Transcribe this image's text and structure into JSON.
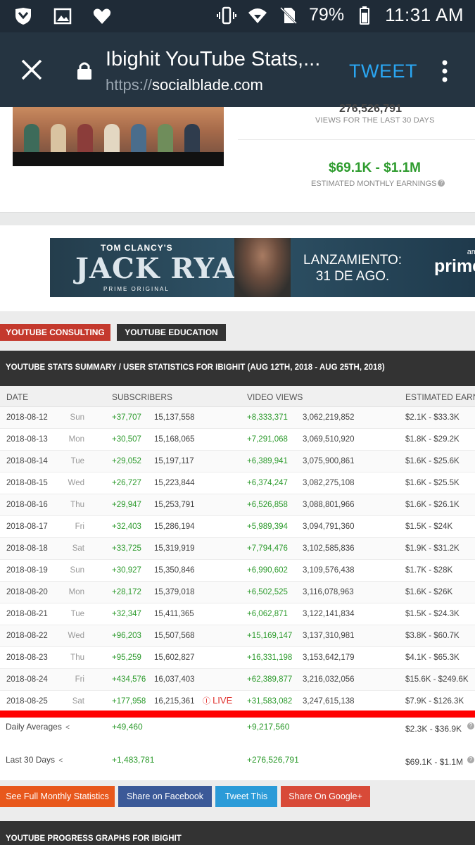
{
  "status_bar": {
    "battery": "79%",
    "time": "11:31 AM",
    "icons": [
      "shield-icon",
      "image-icon",
      "heart-icon",
      "vibrate-icon",
      "wifi-icon",
      "no-sim-icon",
      "battery-icon"
    ]
  },
  "toolbar": {
    "title": "Ibighit YouTube Stats,...",
    "url_protocol": "https://",
    "url_domain": "socialblade.com",
    "tweet_label": "TWEET"
  },
  "top_card": {
    "views_value": "276,526,791",
    "views_label": "VIEWS FOR THE LAST 30 DAYS",
    "earnings_value": "$69.1K - $1.1M",
    "earnings_label": "ESTIMATED MONTHLY EARNINGS"
  },
  "ad": {
    "small": "TOM CLANCY'S",
    "big": "JACK RYAN",
    "sub": "PRIME ORIGINAL",
    "lanz1": "LANZAMIENTO:",
    "lanz2": "31 DE AGO.",
    "brand_top": "ama",
    "brand": "prime"
  },
  "buttons": {
    "consulting": "YOUTUBE CONSULTING",
    "education": "YOUTUBE EDUCATION"
  },
  "summary_title": "YOUTUBE STATS SUMMARY / USER STATISTICS FOR IBIGHIT (AUG 12TH, 2018 - AUG 25TH, 2018)",
  "table": {
    "headers": [
      "DATE",
      "SUBSCRIBERS",
      "VIDEO VIEWS",
      "ESTIMATED EARN"
    ],
    "rows": [
      {
        "date": "2018-08-12",
        "day": "Sun",
        "sub_gain": "+37,707",
        "subs": "15,137,558",
        "view_gain": "+8,333,371",
        "views": "3,062,219,852",
        "earn": "$2.1K  -  $33.3K"
      },
      {
        "date": "2018-08-13",
        "day": "Mon",
        "sub_gain": "+30,507",
        "subs": "15,168,065",
        "view_gain": "+7,291,068",
        "views": "3,069,510,920",
        "earn": "$1.8K  -  $29.2K"
      },
      {
        "date": "2018-08-14",
        "day": "Tue",
        "sub_gain": "+29,052",
        "subs": "15,197,117",
        "view_gain": "+6,389,941",
        "views": "3,075,900,861",
        "earn": "$1.6K  -  $25.6K"
      },
      {
        "date": "2018-08-15",
        "day": "Wed",
        "sub_gain": "+26,727",
        "subs": "15,223,844",
        "view_gain": "+6,374,247",
        "views": "3,082,275,108",
        "earn": "$1.6K  -  $25.5K"
      },
      {
        "date": "2018-08-16",
        "day": "Thu",
        "sub_gain": "+29,947",
        "subs": "15,253,791",
        "view_gain": "+6,526,858",
        "views": "3,088,801,966",
        "earn": "$1.6K  -  $26.1K"
      },
      {
        "date": "2018-08-17",
        "day": "Fri",
        "sub_gain": "+32,403",
        "subs": "15,286,194",
        "view_gain": "+5,989,394",
        "views": "3,094,791,360",
        "earn": "$1.5K  -  $24K"
      },
      {
        "date": "2018-08-18",
        "day": "Sat",
        "sub_gain": "+33,725",
        "subs": "15,319,919",
        "view_gain": "+7,794,476",
        "views": "3,102,585,836",
        "earn": "$1.9K  -  $31.2K"
      },
      {
        "date": "2018-08-19",
        "day": "Sun",
        "sub_gain": "+30,927",
        "subs": "15,350,846",
        "view_gain": "+6,990,602",
        "views": "3,109,576,438",
        "earn": "$1.7K  -  $28K"
      },
      {
        "date": "2018-08-20",
        "day": "Mon",
        "sub_gain": "+28,172",
        "subs": "15,379,018",
        "view_gain": "+6,502,525",
        "views": "3,116,078,963",
        "earn": "$1.6K  -  $26K"
      },
      {
        "date": "2018-08-21",
        "day": "Tue",
        "sub_gain": "+32,347",
        "subs": "15,411,365",
        "view_gain": "+6,062,871",
        "views": "3,122,141,834",
        "earn": "$1.5K  -  $24.3K"
      },
      {
        "date": "2018-08-22",
        "day": "Wed",
        "sub_gain": "+96,203",
        "subs": "15,507,568",
        "view_gain": "+15,169,147",
        "views": "3,137,310,981",
        "earn": "$3.8K  -  $60.7K"
      },
      {
        "date": "2018-08-23",
        "day": "Thu",
        "sub_gain": "+95,259",
        "subs": "15,602,827",
        "view_gain": "+16,331,198",
        "views": "3,153,642,179",
        "earn": "$4.1K  -  $65.3K"
      },
      {
        "date": "2018-08-24",
        "day": "Fri",
        "sub_gain": "+434,576",
        "subs": "16,037,403",
        "view_gain": "+62,389,877",
        "views": "3,216,032,056",
        "earn": "$15.6K  -  $249.6K"
      },
      {
        "date": "2018-08-25",
        "day": "Sat",
        "sub_gain": "+177,958",
        "subs": "16,215,361",
        "view_gain": "+31,583,082",
        "views": "3,247,615,138",
        "earn": "$7.9K  -  $126.3K",
        "live": "LIVE"
      }
    ]
  },
  "averages": {
    "daily_label": "Daily Averages",
    "daily_subs": "+49,460",
    "daily_views": "+9,217,560",
    "daily_earn": "$2.3K  -  $36.9K",
    "last30_label": "Last 30 Days",
    "last30_subs": "+1,483,781",
    "last30_views": "+276,526,791",
    "last30_earn": "$69.1K  -  $1.1M"
  },
  "actions": {
    "monthly": "See Full Monthly Statistics",
    "facebook": "Share on Facebook",
    "tweet": "Tweet This",
    "google": "Share On Google+"
  },
  "graphs_title": "YOUTUBE PROGRESS GRAPHS FOR IBIGHIT",
  "colors": {
    "toolbar": "#253441",
    "tweet": "#2aa6f2",
    "positive": "#2d9b2d",
    "live": "#e0302d",
    "highlight": "#ff0000"
  }
}
